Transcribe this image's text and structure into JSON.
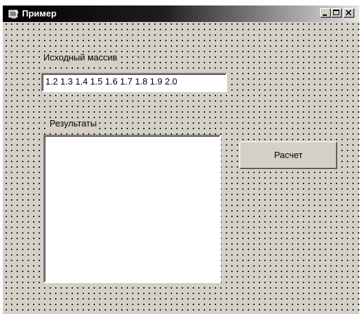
{
  "window": {
    "title": "Пример",
    "icon": "app-icon"
  },
  "caption_buttons": {
    "minimize_icon": "minimize-icon",
    "maximize_icon": "maximize-icon",
    "close_icon": "close-icon"
  },
  "form": {
    "source_label": "Исходный массив",
    "source_value": "1.2 1.3 1.4 1.5 1.6 1.7 1.8 1.9 2.0",
    "results_label": "Результаты",
    "results_items": [],
    "calc_button_label": "Расчет"
  },
  "colors": {
    "window_face": "#d4d0c8",
    "title_gradient_start": "#000000",
    "title_gradient_end": "#e4e4e4",
    "field_background": "#ffffff"
  }
}
